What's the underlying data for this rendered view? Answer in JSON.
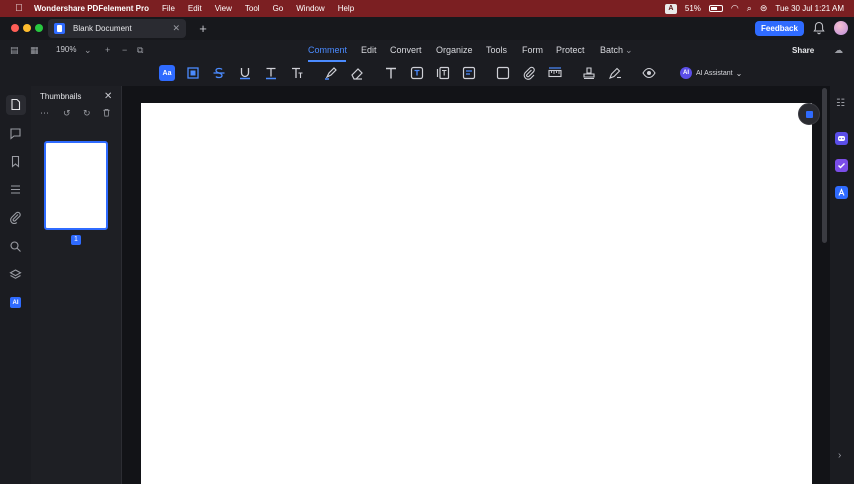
{
  "menubar": {
    "app_name": "Wondershare PDFelement Pro",
    "menus": [
      "File",
      "Edit",
      "View",
      "Tool",
      "Go",
      "Window",
      "Help"
    ],
    "input_badge": "A",
    "battery": "51%",
    "clock": "Tue 30 Jul  1:21 AM"
  },
  "window": {
    "tab_title": "Blank Document",
    "feedback_label": "Feedback"
  },
  "toolbar": {
    "zoom": "190%",
    "tabs": [
      "Comment",
      "Edit",
      "Convert",
      "Organize",
      "Tools",
      "Form",
      "Protect",
      "Batch"
    ],
    "active_tab": "Comment",
    "share_label": "Share",
    "ai_assistant_label": "AI Assistant",
    "ai_badge": "AI",
    "aa_label": "Aa"
  },
  "thumbnails": {
    "title": "Thumbnails",
    "page_number": "1"
  },
  "rail": {
    "ai_label": "AI"
  },
  "colors": {
    "accent": "#2f6bff",
    "menubar": "#7b1f22",
    "active_tab_text": "#4b8bff"
  }
}
